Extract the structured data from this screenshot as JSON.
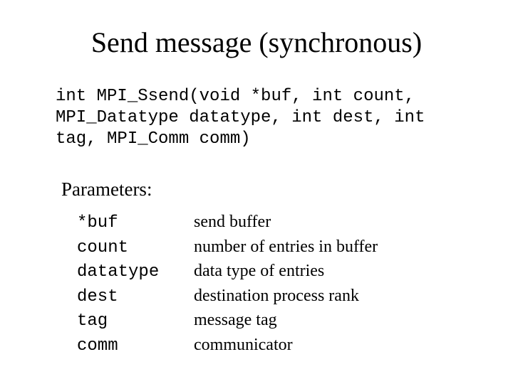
{
  "title": "Send message (synchronous)",
  "signature": "int MPI_Ssend(void *buf, int count, MPI_Datatype datatype, int dest, int tag, MPI_Comm comm)",
  "params_heading": "Parameters:",
  "params": [
    {
      "name": "*buf",
      "desc": "send buffer"
    },
    {
      "name": "count",
      "desc": "number of entries in buffer"
    },
    {
      "name": "datatype",
      "desc": "data type of entries"
    },
    {
      "name": "dest",
      "desc": "destination process rank"
    },
    {
      "name": "tag",
      "desc": "message tag"
    },
    {
      "name": "comm",
      "desc": "communicator"
    }
  ]
}
